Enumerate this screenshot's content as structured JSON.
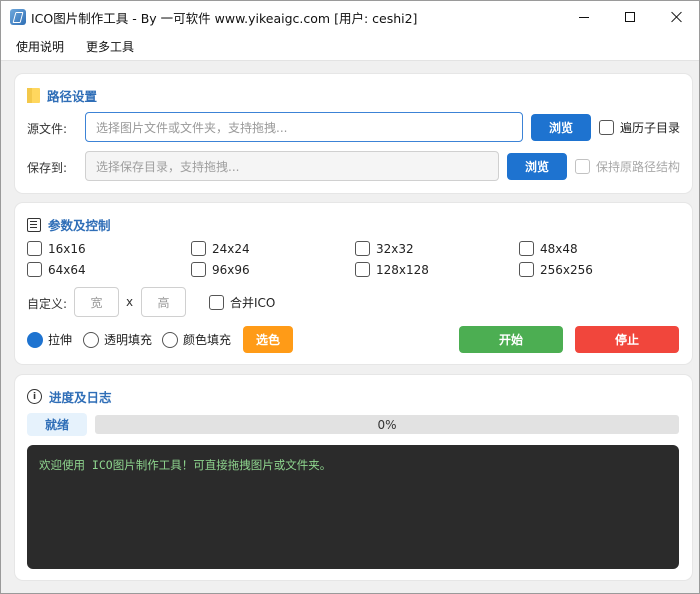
{
  "window": {
    "title": "ICO图片制作工具 - By 一可软件 www.yikeaigc.com [用户: ceshi2]"
  },
  "menu": {
    "items": [
      "使用说明",
      "更多工具"
    ]
  },
  "path_panel": {
    "title": "路径设置",
    "source_label": "源文件:",
    "source_placeholder": "选择图片文件或文件夹，支持拖拽...",
    "browse_label": "浏览",
    "recurse_label": "遍历子目录",
    "save_label": "保存到:",
    "save_placeholder": "选择保存目录，支持拖拽...",
    "save_browse_label": "浏览",
    "keep_structure_label": "保持原路径结构"
  },
  "params_panel": {
    "title": "参数及控制",
    "sizes": [
      "16x16",
      "24x24",
      "32x32",
      "48x48",
      "64x64",
      "96x96",
      "128x128",
      "256x256"
    ],
    "custom_label": "自定义:",
    "width_placeholder": "宽",
    "times": "x",
    "height_placeholder": "高",
    "merge_label": "合并ICO",
    "fill_modes": [
      {
        "label": "拉伸",
        "selected": true
      },
      {
        "label": "透明填充",
        "selected": false
      },
      {
        "label": "颜色填充",
        "selected": false
      }
    ],
    "pick_color_label": "选色",
    "start_label": "开始",
    "stop_label": "停止"
  },
  "progress_panel": {
    "title": "进度及日志",
    "status": "就绪",
    "progress_percent": 0,
    "progress_text": "0%",
    "log_text": "欢迎使用 ICO图片制作工具！可直接拖拽图片或文件夹。"
  },
  "colors": {
    "accent_blue": "#1e73d0",
    "title_blue": "#2f6eb7",
    "orange": "#ff9b17",
    "green": "#4cae52",
    "red": "#f1463c",
    "log_bg": "#2b2b2b",
    "log_text": "#8ed58e"
  }
}
